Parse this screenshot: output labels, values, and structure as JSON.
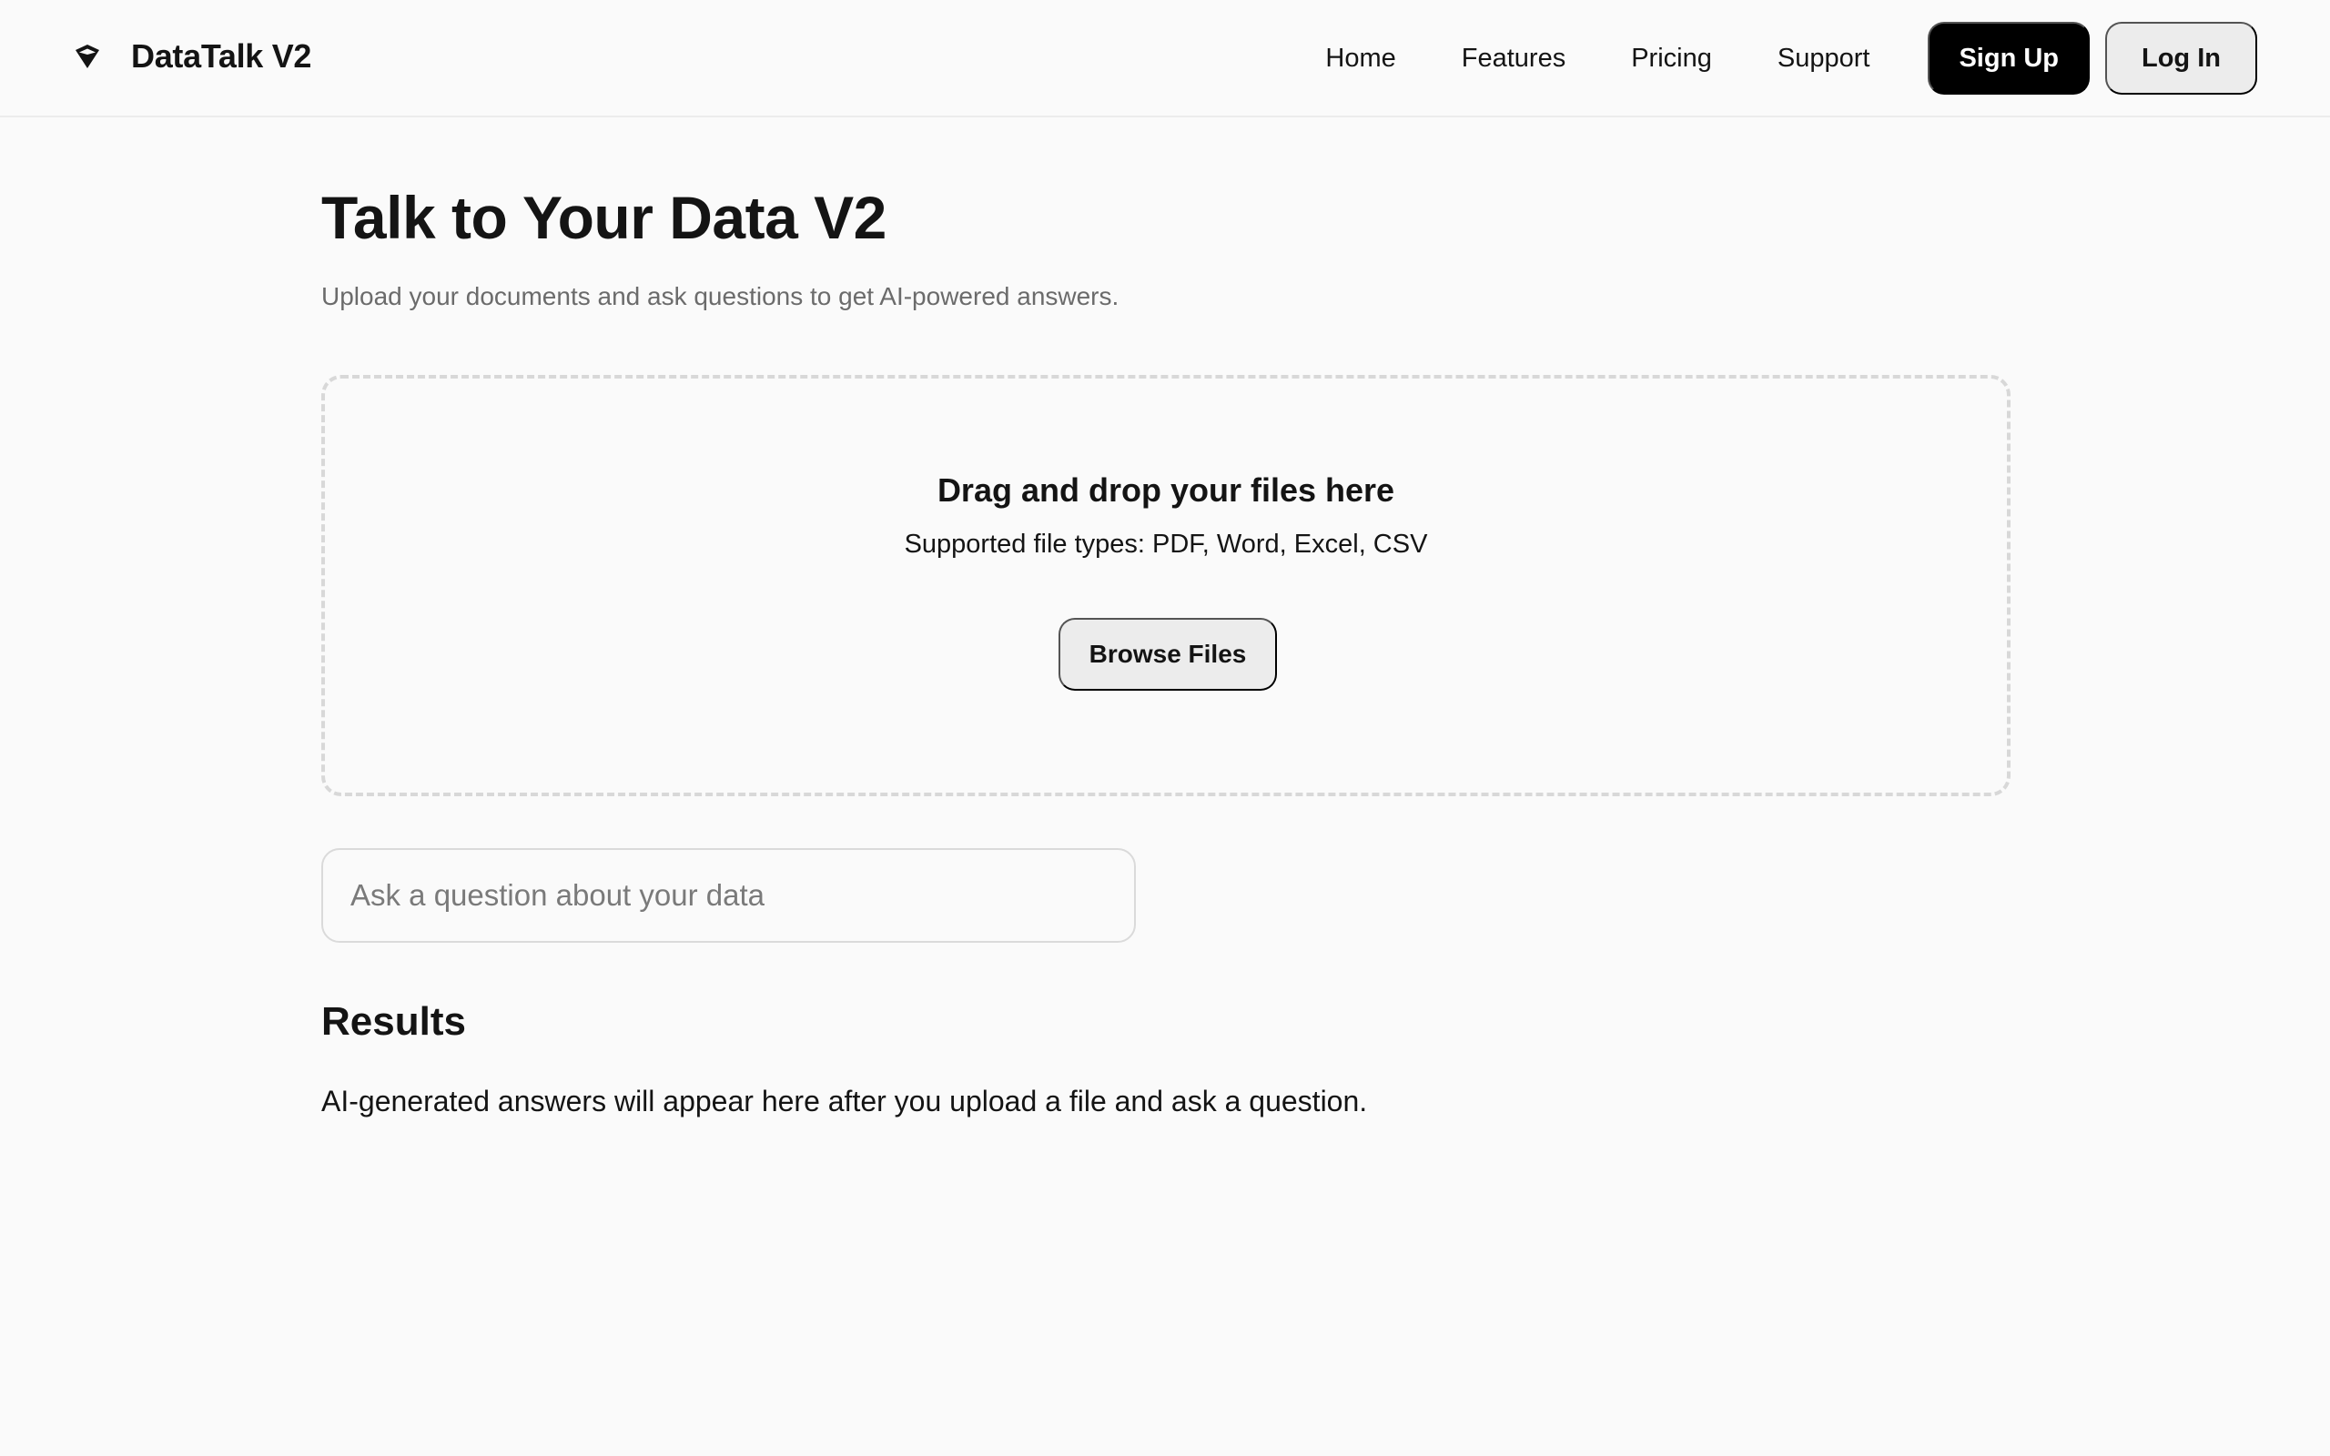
{
  "header": {
    "brand": "DataTalk V2",
    "brand_icon": "diamond-icon",
    "nav": [
      "Home",
      "Features",
      "Pricing",
      "Support"
    ],
    "signup_label": "Sign Up",
    "login_label": "Log In"
  },
  "main": {
    "title": "Talk to Your Data V2",
    "subtitle": "Upload your documents and ask questions to get AI-powered answers.",
    "dropzone": {
      "title": "Drag and drop your files here",
      "types": "Supported file types: PDF, Word, Excel, CSV",
      "button": "Browse Files"
    },
    "question": {
      "placeholder": "Ask a question about your data",
      "value": ""
    },
    "results": {
      "heading": "Results",
      "text": "AI-generated answers will appear here after you upload a file and ask a question."
    }
  },
  "colors": {
    "background": "#fafafa",
    "text": "#141414",
    "muted": "#6b6b6b",
    "primary_button": "#000000",
    "secondary_button": "#ececec",
    "dropzone_border": "#d8d8d8"
  }
}
